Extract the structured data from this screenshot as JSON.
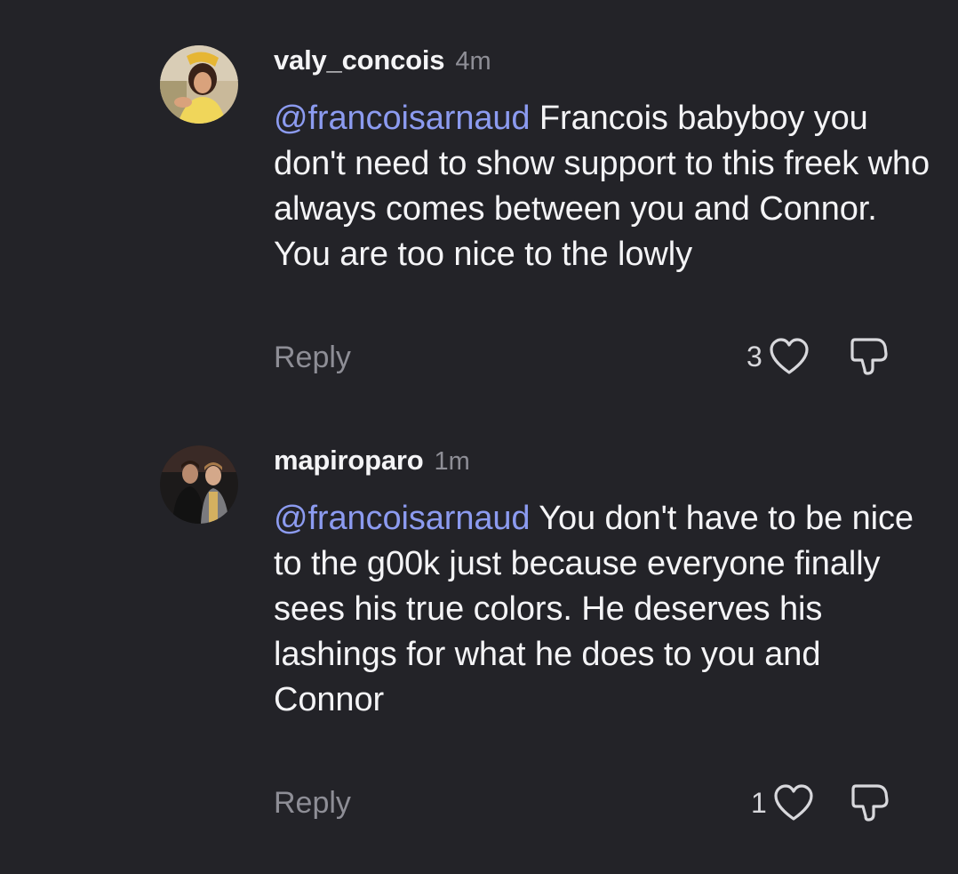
{
  "comments": [
    {
      "username": "valy_concois",
      "time": "4m",
      "mention": "@francoisarnaud",
      "text": " Francois babyboy you don't need to show support to this freek who always comes between you and Connor. You are too nice to the lowly",
      "reply_label": "Reply",
      "likes": "3",
      "avatar_icon": "profile-photo-woman-yellow",
      "like_icon": "heart-outline",
      "dislike_icon": "thumbs-down-outline"
    },
    {
      "username": "mapiroparo",
      "time": "1m",
      "mention": "@francoisarnaud",
      "text": " You don't have to be nice to the g00k just because everyone finally sees his true colors. He deserves his lashings for what he does to you and Connor",
      "reply_label": "Reply",
      "likes": "1",
      "avatar_icon": "profile-photo-two-men",
      "like_icon": "heart-outline",
      "dislike_icon": "thumbs-down-outline"
    }
  ],
  "colors": {
    "background": "#232328",
    "mention": "#8c9bf0",
    "muted": "#8e8e96",
    "text": "#f4f4f6"
  }
}
